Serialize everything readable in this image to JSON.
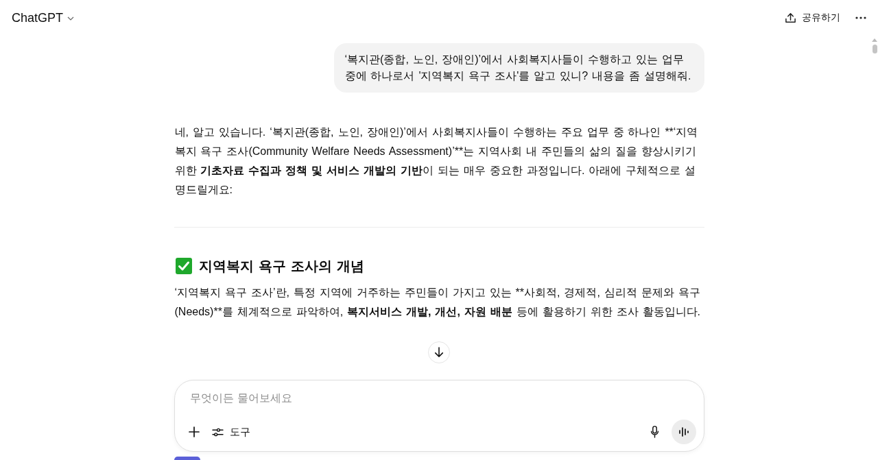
{
  "header": {
    "title": "ChatGPT",
    "share_label": "공유하기"
  },
  "user_message": {
    "text": "‘복지관(종합, 노인, 장애인)’에서 사회복지사들이 수행하고 있는 업무 중에 하나로서 '지역복지 욕구 조사'를 알고 있니? 내용을 좀 설명해줘."
  },
  "answer": {
    "blocks": [
      {
        "kind": "paragraph",
        "runs": [
          {
            "text": "네, 알고 있습니다. ‘복지관(종합, 노인, 장애인)’에서 사회복지사들이 수행하는 주요 업무 중 하나인 **‘지역복지 욕구 조사(Community Welfare Needs Assessment)’**는 지역사회 내 주민들의 삶의 질을 향상시키기 위한 ",
            "bold": false
          },
          {
            "text": "기초자료 수집과 정책 및 서비스 개발의 기반",
            "bold": true
          },
          {
            "text": "이 되는 매우 중요한 과정입니다. 아래에 구체적으로 설명드릴게요:",
            "bold": false
          }
        ]
      },
      {
        "kind": "divider"
      },
      {
        "kind": "heading",
        "text": "지역복지 욕구 조사의 개념"
      },
      {
        "kind": "paragraph",
        "runs": [
          {
            "text": "‘지역복지 욕구 조사’란, 특정 지역에 거주하는 주민들이 가지고 있는 **사회적, 경제적, 심리적 문제와 욕구(Needs)**를 체계적으로 파악하여, ",
            "bold": false
          },
          {
            "text": "복지서비스 개발, 개선, 자원 배분",
            "bold": true
          },
          {
            "text": " 등에 활용하기 위한 조사 활동입니다.",
            "bold": false
          }
        ]
      }
    ]
  },
  "composer": {
    "placeholder": "무엇이든 물어보세요",
    "tools_label": "도구"
  }
}
